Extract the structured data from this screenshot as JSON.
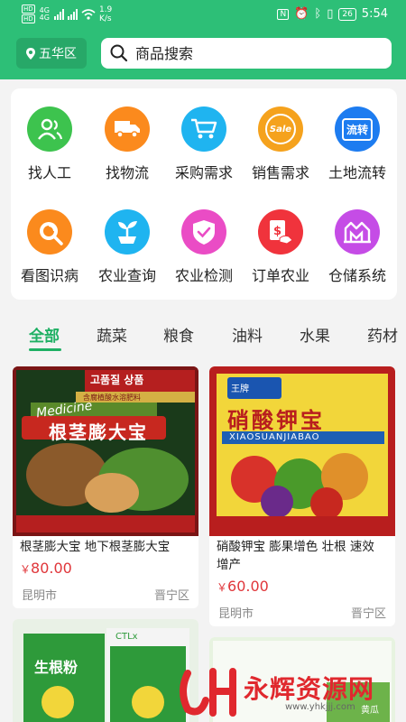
{
  "status": {
    "hd1": "HD",
    "hd2": "HD",
    "net1": "4G",
    "net2": "4G",
    "speed_value": "1.9",
    "speed_unit": "K/s",
    "nfc": "N",
    "battery": "26",
    "time": "5:54"
  },
  "header": {
    "location": "五华区",
    "search_placeholder": "商品搜索"
  },
  "services": [
    {
      "label": "找人工",
      "icon": "people-icon",
      "color": "#3dc34e"
    },
    {
      "label": "找物流",
      "icon": "truck-icon",
      "color": "#fb8a1d"
    },
    {
      "label": "采购需求",
      "icon": "cart-icon",
      "color": "#1fb4f0"
    },
    {
      "label": "销售需求",
      "icon": "sale-icon",
      "color": "#f5a21d",
      "text": "Sale"
    },
    {
      "label": "土地流转",
      "icon": "land-transfer-icon",
      "color": "#1d7cf0",
      "text": "流转"
    },
    {
      "label": "看图识病",
      "icon": "magnifier-icon",
      "color": "#fb8a1d"
    },
    {
      "label": "农业查询",
      "icon": "seedling-icon",
      "color": "#1fb4f0"
    },
    {
      "label": "农业检测",
      "icon": "shield-check-icon",
      "color": "#ea4cc5"
    },
    {
      "label": "订单农业",
      "icon": "money-order-icon",
      "color": "#f0333c"
    },
    {
      "label": "仓储系统",
      "icon": "warehouse-icon",
      "color": "#c54ce6"
    }
  ],
  "tabs": [
    "全部",
    "蔬菜",
    "粮食",
    "油料",
    "水果",
    "药材"
  ],
  "products": [
    {
      "name": "根茎膨大宝 地下根茎膨大宝",
      "currency": "￥",
      "price": "80.00",
      "city": "昆明市",
      "district": "晋宁区",
      "img_title": "根茎膨大宝",
      "img_top": "고품질 상품",
      "img_sub": "含腐植酸水溶肥料",
      "img_brand": "Medicine"
    },
    {
      "name": "硝酸钾宝 膨果增色 壮根 速效 增产",
      "currency": "￥",
      "price": "60.00",
      "city": "昆明市",
      "district": "晋宁区",
      "img_title": "硝酸钾宝",
      "img_sub": "XIAOSUANJIABAO",
      "img_brand": "王牌"
    },
    {
      "img_title": "生根粉",
      "img_top": "CTLx"
    },
    {
      "img_title": "黄瓜"
    }
  ],
  "watermark": {
    "text": "永辉资源网",
    "url": "www.yhkjjj.com"
  },
  "colors": {
    "primary": "#2dbf77",
    "price": "#e0363a",
    "tab_active": "#1fb064"
  }
}
